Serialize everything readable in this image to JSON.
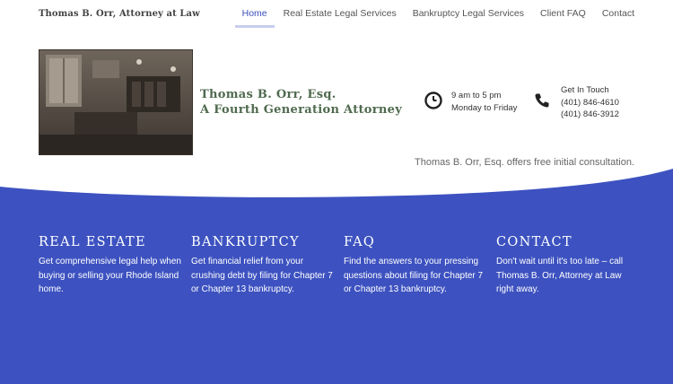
{
  "site": {
    "title": "Thomas B. Orr, Attorney at Law"
  },
  "nav": {
    "items": [
      {
        "label": "Home",
        "active": true
      },
      {
        "label": "Real Estate Legal Services",
        "active": false
      },
      {
        "label": "Bankruptcy Legal Services",
        "active": false
      },
      {
        "label": "Client FAQ",
        "active": false
      },
      {
        "label": "Contact",
        "active": false
      }
    ]
  },
  "hero": {
    "name_line1": "Thomas B. Orr, Esq.",
    "name_line2": "A Fourth Generation Attorney",
    "hours_icon": "clock-icon",
    "hours_line1": "9 am to 5 pm",
    "hours_line2": "Monday to Friday",
    "phone_icon": "phone-icon",
    "contact_line1": "Get In Touch",
    "contact_line2": "(401) 846-4610",
    "contact_line3": "(401) 846-3912",
    "consultation": "Thomas B. Orr, Esq. offers free initial consultation."
  },
  "services": [
    {
      "heading": "REAL ESTATE",
      "text": "Get comprehensive legal help when buying or selling your Rhode Island home."
    },
    {
      "heading": "BANKRUPTCY",
      "text": "Get financial relief from your crushing debt by filing for Chapter 7 or Chapter 13 bankruptcy."
    },
    {
      "heading": "FAQ",
      "text": "Find the answers to your pressing questions about filing for Chapter 7 or Chapter 13 bankruptcy."
    },
    {
      "heading": "CONTACT",
      "text": "Don't wait until it's too late – call Thomas B. Orr, Attorney at Law right away."
    }
  ],
  "colors": {
    "accent": "#3b4fbb",
    "band": "#3d52c0",
    "hero_text": "#4f6a4f"
  }
}
